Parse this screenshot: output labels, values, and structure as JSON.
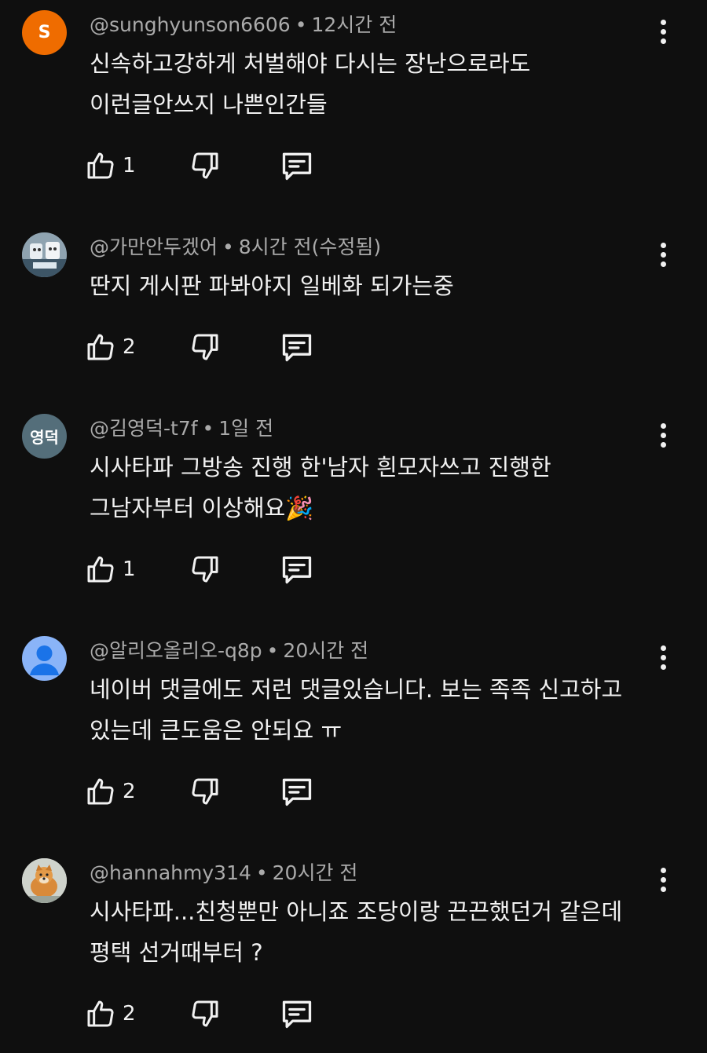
{
  "comments": [
    {
      "avatar_letter": "S",
      "handle": "@sunghyunson6606",
      "time": "12시간 전",
      "lines": [
        "신속하고강하게 처벌해야 다시는 장난으로라도",
        "이런글안쓰지 나쁜인간들"
      ],
      "likes": "1"
    },
    {
      "avatar_letter": "",
      "handle": "@가만안두겠어",
      "time": "8시간 전(수정됨)",
      "lines": [
        "딴지 게시판 파봐야지 일베화 되가는중"
      ],
      "likes": "2"
    },
    {
      "avatar_letter": "영덕",
      "handle": "@김영덕-t7f",
      "time": "1일 전",
      "lines": [
        "시사타파 그방송 진행 한'남자 흰모자쓰고 진행한",
        "그남자부터  이상해요🎉"
      ],
      "likes": "1"
    },
    {
      "avatar_letter": "",
      "handle": "@알리오올리오-q8p",
      "time": "20시간 전",
      "lines": [
        "네이버 댓글에도 저런 댓글있습니다. 보는 족족 신고하고",
        "있는데 큰도움은 안되요 ㅠ"
      ],
      "likes": "2"
    },
    {
      "avatar_letter": "",
      "handle": "@hannahmy314",
      "time": "20시간 전",
      "lines": [
        "시사타파...친청뿐만 아니죠 조당이랑 끈끈했던거 같은데",
        "평택 선거때부터 ?"
      ],
      "likes": "2"
    }
  ],
  "separator": "•",
  "icons": {
    "like": "thumbs-up-icon",
    "dislike": "thumbs-down-icon",
    "reply": "reply-icon",
    "more": "more-vertical-icon"
  }
}
